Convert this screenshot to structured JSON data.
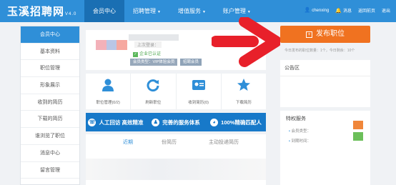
{
  "header": {
    "logo": "玉溪招聘网",
    "logo_version": "V4.0",
    "nav": [
      {
        "label": "会员中心",
        "active": true
      },
      {
        "label": "招聘管理"
      },
      {
        "label": "增值服务"
      },
      {
        "label": "账户管理"
      }
    ],
    "user": "chenxing",
    "links": [
      "消息",
      "返回前页",
      "退出"
    ]
  },
  "sidebar": {
    "items": [
      {
        "label": "会员中心",
        "active": true
      },
      {
        "label": "基本资料"
      },
      {
        "label": "职位管理"
      },
      {
        "label": "形象展示"
      },
      {
        "label": "收到的简历"
      },
      {
        "label": "下载的简历"
      },
      {
        "label": "谁浏览了职位"
      },
      {
        "label": "消息中心"
      },
      {
        "label": "留言管理"
      }
    ]
  },
  "profile": {
    "line": "上次登录：",
    "verified": "企业已认证",
    "badge_vip": "会员类型：VIP体验会员",
    "badge_trial": "招聘会员"
  },
  "quick_actions": [
    {
      "label": "职位管理(0/2)",
      "icon": "user-icon"
    },
    {
      "label": "刷新职位",
      "icon": "refresh-icon"
    },
    {
      "label": "收到简历(0)",
      "icon": "resume-icon"
    },
    {
      "label": "下载简历",
      "icon": "star-icon"
    }
  ],
  "banner": [
    {
      "label": "人工回访 高效精准",
      "icon": "phone-icon"
    },
    {
      "label": "完善的服务体系",
      "icon": "service-icon"
    },
    {
      "label": "100%精确匹配人",
      "icon": "match-icon"
    }
  ],
  "tabs": [
    "近期",
    "份简历",
    "主动投递简历"
  ],
  "right": {
    "publish_label": "发布职位",
    "publish_note": "今日发布的职位数量：1个，今日剩余：10个",
    "announce_title": "公告区",
    "service_title": "特权服务",
    "service_items": [
      "会员类型：",
      "到期时间："
    ]
  },
  "colors": {
    "header_bg": "#2f8fd8",
    "publish_bg": "#f07220",
    "arrow": "#e8202a",
    "banner_bg": "#1779c9"
  }
}
